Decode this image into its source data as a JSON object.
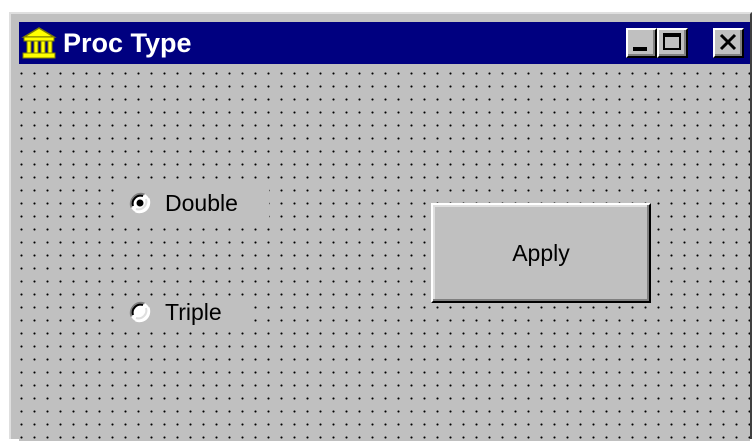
{
  "window": {
    "title": "Proc Type",
    "icon": "building-icon",
    "controls": [
      "minimize-icon",
      "maximize-icon",
      "close-icon"
    ]
  },
  "form": {
    "radio_options": [
      {
        "label": "Double",
        "selected": true
      },
      {
        "label": "Triple",
        "selected": false
      }
    ],
    "apply_label": "Apply"
  },
  "colors": {
    "titlebar": "#000080",
    "face": "#c0c0c0",
    "grid_dot": "#000000"
  }
}
